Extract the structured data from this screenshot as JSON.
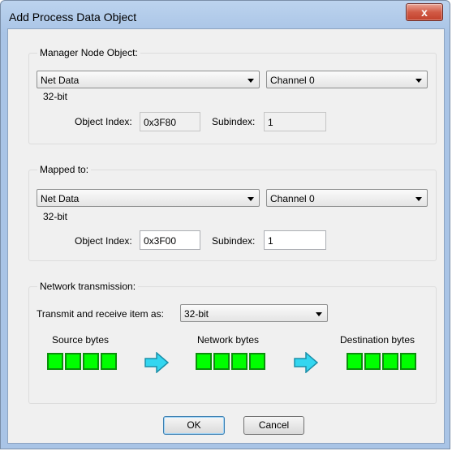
{
  "window": {
    "title": "Add Process Data Object",
    "close_glyph": "x"
  },
  "manager": {
    "label": "Manager Node Object:",
    "data_combo": "Net Data",
    "channel_combo": "Channel 0",
    "bits": "32-bit",
    "index_label": "Object Index:",
    "index_value": "0x3F80",
    "subindex_label": "Subindex:",
    "subindex_value": "1"
  },
  "mapped": {
    "label": "Mapped to:",
    "data_combo": "Net Data",
    "channel_combo": "Channel 0",
    "bits": "32-bit",
    "index_label": "Object Index:",
    "index_value": "0x3F00",
    "subindex_label": "Subindex:",
    "subindex_value": "1"
  },
  "network": {
    "label": "Network transmission:",
    "transmit_label": "Transmit and receive item as:",
    "transmit_value": "32-bit",
    "source_label": "Source bytes",
    "network_label": "Network bytes",
    "dest_label": "Destination bytes"
  },
  "buttons": {
    "ok": "OK",
    "cancel": "Cancel"
  },
  "colors": {
    "byte_fill": "#00ff00",
    "arrow_fill": "#33d6f0"
  }
}
